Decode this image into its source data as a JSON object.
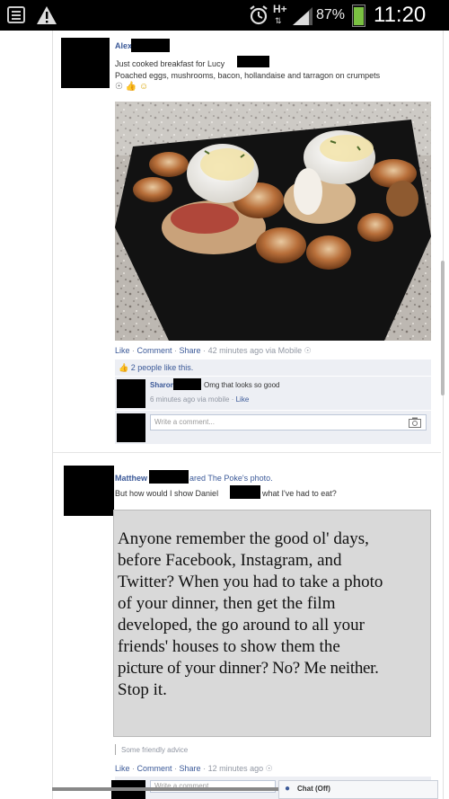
{
  "status_bar": {
    "network_label": "H+",
    "battery_percent": "87%",
    "time": "11:20",
    "battery_level": 0.87
  },
  "post1": {
    "author": "Alex",
    "line1": "Just cooked breakfast for Lucy",
    "line2": "Poached eggs, mushrooms, bacon, hollandaise and tarragon on crumpets",
    "actions": {
      "like": "Like",
      "comment": "Comment",
      "share": "Share",
      "meta": "42 minutes ago via Mobile"
    },
    "likes_text": "2 people like this.",
    "comment": {
      "author": "Sharon",
      "text": "Omg that looks so good",
      "meta": "6 minutes ago via mobile",
      "like": "Like"
    },
    "comment_placeholder": "Write a comment..."
  },
  "post2": {
    "author": "Matthew",
    "shared_text": "ared The Poke's photo.",
    "body_prefix": "But how would I show Daniel",
    "body_suffix": "what I've had to eat?",
    "quote_lines": [
      "Anyone remember the good ol' days,",
      "before Facebook, Instagram, and",
      "Twitter? When you had to take a photo",
      "of your dinner, then get the film",
      "developed, the go around to all your",
      "friends' houses to show them the",
      "picture of your dinner? No? Me neither.",
      "Stop it."
    ],
    "caption": "Some friendly advice",
    "actions": {
      "like": "Like",
      "comment": "Comment",
      "share": "Share",
      "meta": "12 minutes ago"
    },
    "comment_placeholder": "Write a comment..."
  },
  "chat": {
    "label": "Chat (Off)"
  }
}
